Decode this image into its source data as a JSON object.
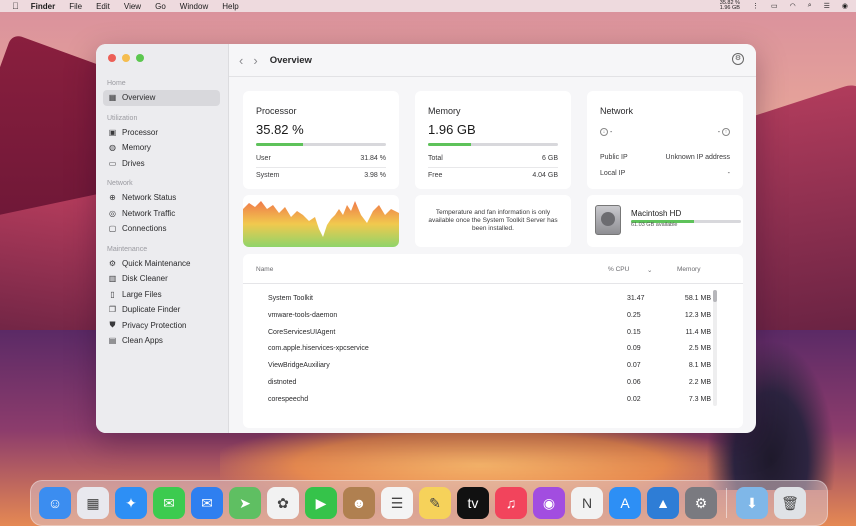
{
  "menubar": {
    "apple_icon": "apple-icon",
    "items": [
      "Finder",
      "File",
      "Edit",
      "View",
      "Go",
      "Window",
      "Help"
    ],
    "cpu_stat": "35.82 %",
    "mem_stat": "1.96 GB"
  },
  "sidebar": {
    "sections": [
      {
        "title": "Home",
        "items": [
          {
            "label": "Overview",
            "icon": "grid-icon",
            "active": true
          }
        ]
      },
      {
        "title": "Utilization",
        "items": [
          {
            "label": "Processor",
            "icon": "cpu-icon"
          },
          {
            "label": "Memory",
            "icon": "memory-icon"
          },
          {
            "label": "Drives",
            "icon": "drive-icon"
          }
        ]
      },
      {
        "title": "Network",
        "items": [
          {
            "label": "Network Status",
            "icon": "globe-icon"
          },
          {
            "label": "Network Traffic",
            "icon": "traffic-icon"
          },
          {
            "label": "Connections",
            "icon": "monitor-icon"
          }
        ]
      },
      {
        "title": "Maintenance",
        "items": [
          {
            "label": "Quick Maintenance",
            "icon": "wrench-icon"
          },
          {
            "label": "Disk Cleaner",
            "icon": "broom-icon"
          },
          {
            "label": "Large Files",
            "icon": "file-icon"
          },
          {
            "label": "Duplicate Finder",
            "icon": "copy-icon"
          },
          {
            "label": "Privacy Protection",
            "icon": "shield-icon"
          },
          {
            "label": "Clean Apps",
            "icon": "apps-icon"
          }
        ]
      }
    ]
  },
  "toolbar": {
    "title": "Overview"
  },
  "processor": {
    "title": "Processor",
    "value": "35.82 %",
    "usage": 0.36,
    "rows": [
      {
        "label": "User",
        "value": "31.84 %"
      },
      {
        "label": "System",
        "value": "3.98 %"
      }
    ]
  },
  "memory": {
    "title": "Memory",
    "value": "1.96 GB",
    "usage": 0.33,
    "rows": [
      {
        "label": "Total",
        "value": "6 GB"
      },
      {
        "label": "Free",
        "value": "4.04 GB"
      }
    ]
  },
  "network": {
    "title": "Network",
    "down": "-",
    "up": "-",
    "rows": [
      {
        "label": "Public IP",
        "value": "Unknown IP address"
      },
      {
        "label": "Local IP",
        "value": "-"
      }
    ]
  },
  "notice": {
    "text": "Temperature and fan information is only available once the System Toolkit Server has been installed."
  },
  "disk": {
    "name": "Macintosh HD",
    "available": "61.03 GB available"
  },
  "processes": {
    "headers": {
      "name": "Name",
      "cpu": "% CPU",
      "memory": "Memory"
    },
    "rows": [
      {
        "name": "System Toolkit",
        "cpu": "31.47",
        "memory": "58.1 MB"
      },
      {
        "name": "vmware-tools-daemon",
        "cpu": "0.25",
        "memory": "12.3 MB"
      },
      {
        "name": "CoreServicesUIAgent",
        "cpu": "0.15",
        "memory": "11.4 MB"
      },
      {
        "name": "com.apple.hiservices-xpcservice",
        "cpu": "0.09",
        "memory": "2.5 MB"
      },
      {
        "name": "ViewBridgeAuxiliary",
        "cpu": "0.07",
        "memory": "8.1 MB"
      },
      {
        "name": "distnoted",
        "cpu": "0.06",
        "memory": "2.2 MB"
      },
      {
        "name": "corespeechd",
        "cpu": "0.02",
        "memory": "7.3 MB"
      }
    ]
  },
  "dock": {
    "apps": [
      {
        "name": "finder",
        "color": "#3b8df0",
        "glyph": "☺"
      },
      {
        "name": "launchpad",
        "color": "#e8e8ee",
        "glyph": "▦"
      },
      {
        "name": "safari",
        "color": "#2d8ff5",
        "glyph": "✦"
      },
      {
        "name": "messages",
        "color": "#3ccb4f",
        "glyph": "✉"
      },
      {
        "name": "mail",
        "color": "#2f7ff0",
        "glyph": "✉"
      },
      {
        "name": "maps",
        "color": "#5fbf62",
        "glyph": "➤"
      },
      {
        "name": "photos",
        "color": "#f2f2f2",
        "glyph": "✿"
      },
      {
        "name": "facetime",
        "color": "#35c34a",
        "glyph": "▶"
      },
      {
        "name": "contacts",
        "color": "#b08050",
        "glyph": "☻"
      },
      {
        "name": "reminders",
        "color": "#f4f4f4",
        "glyph": "☰"
      },
      {
        "name": "notes",
        "color": "#f6d25a",
        "glyph": "✎"
      },
      {
        "name": "tv",
        "color": "#111111",
        "glyph": "tv"
      },
      {
        "name": "music",
        "color": "#f2445c",
        "glyph": "♫"
      },
      {
        "name": "podcasts",
        "color": "#a24de0",
        "glyph": "◉"
      },
      {
        "name": "news",
        "color": "#f2f2f2",
        "glyph": "N"
      },
      {
        "name": "app-store",
        "color": "#2d8ff5",
        "glyph": "A"
      },
      {
        "name": "system-toolkit",
        "color": "#2e7dd6",
        "glyph": "▲"
      },
      {
        "name": "system-preferences",
        "color": "#7a7a80",
        "glyph": "⚙"
      },
      {
        "name": "downloads",
        "color": "#7fb7e8",
        "glyph": "⬇"
      },
      {
        "name": "trash",
        "color": "#dfe2e6",
        "glyph": "🗑"
      }
    ]
  }
}
